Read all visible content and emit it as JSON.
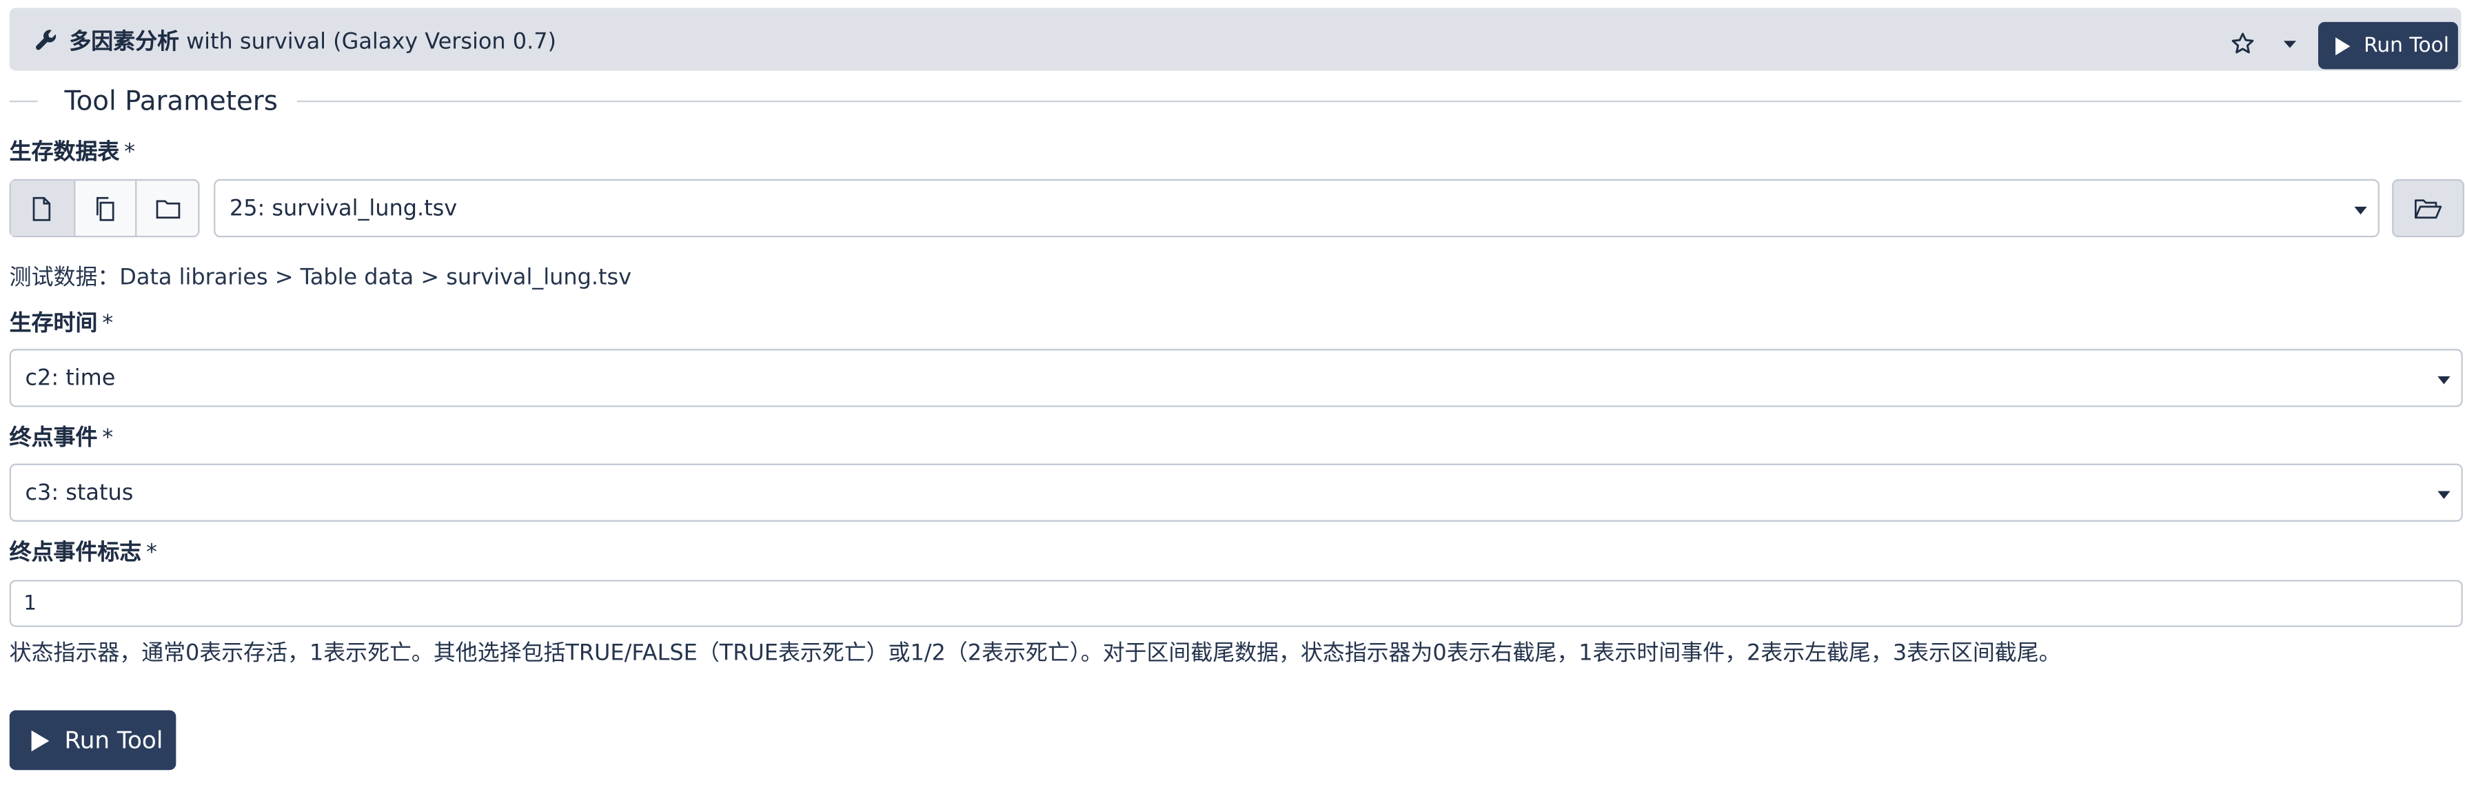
{
  "header": {
    "title_bold": "多因素分析",
    "title_rest": " with survival (Galaxy Version 0.7)",
    "run_label": "Run Tool"
  },
  "section": {
    "title": "Tool Parameters"
  },
  "fields": {
    "table": {
      "label": "生存数据表",
      "required": "*",
      "value": "25: survival_lung.tsv",
      "help": "测试数据：Data libraries > Table data > survival_lung.tsv"
    },
    "time": {
      "label": "生存时间",
      "required": "*",
      "value": "c2: time"
    },
    "event": {
      "label": "终点事件",
      "required": "*",
      "value": "c3: status"
    },
    "event_flag": {
      "label": "终点事件标志",
      "required": "*",
      "value": "1",
      "help": "状态指示器，通常0表示存活，1表示死亡。其他选择包括TRUE/FALSE（TRUE表示死亡）或1/2（2表示死亡）。对于区间截尾数据，状态指示器为0表示右截尾，1表示时间事件，2表示左截尾，3表示区间截尾。"
    }
  },
  "footer": {
    "run_label": "Run Tool"
  },
  "colors": {
    "header_bg": "#dee2e8",
    "primary": "#2c3e5e",
    "text": "#25344d",
    "border": "#c3c9d2"
  },
  "icons": [
    "wrench-icon",
    "star-icon",
    "caret-down-icon",
    "play-icon",
    "file-icon",
    "copy-icon",
    "folder-icon",
    "folder-open-icon",
    "chevron-down-icon"
  ]
}
